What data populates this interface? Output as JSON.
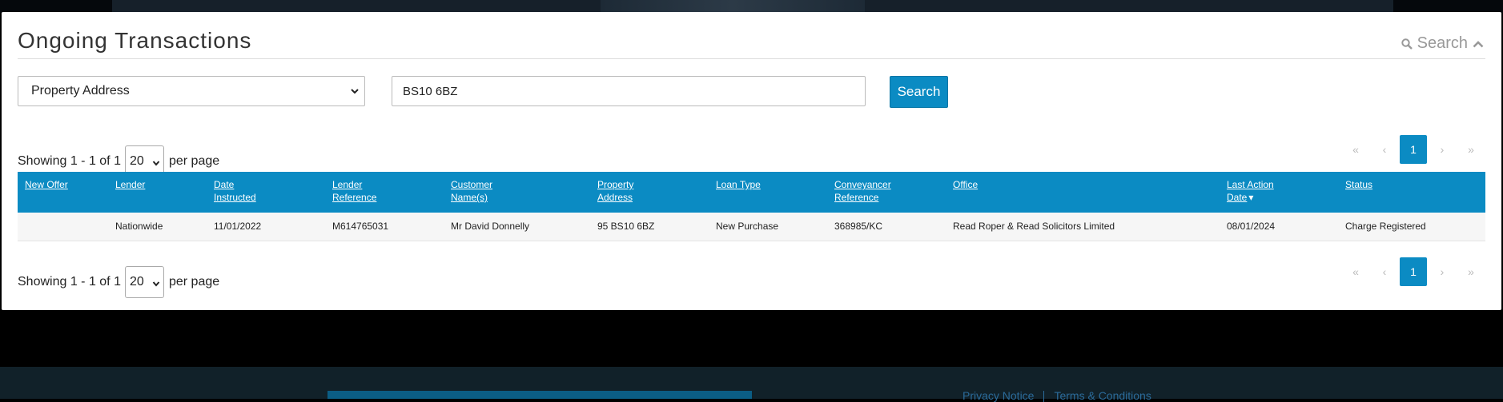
{
  "footer": {
    "links": [
      "Privacy Notice",
      "Terms & Conditions"
    ]
  },
  "panel": {
    "title": "Ongoing Transactions",
    "search_toggle_label": "Search"
  },
  "search": {
    "field_select_value": "Property Address",
    "query_value": "BS10 6BZ",
    "button_label": "Search"
  },
  "pager": {
    "showing_text": "Showing 1 - 1 of 1",
    "per_page_value": "20",
    "per_page_label": "per page",
    "first": "«",
    "prev": "‹",
    "current": "1",
    "next": "›",
    "last": "»"
  },
  "table": {
    "headers": [
      {
        "l1": "New Offer",
        "l2": ""
      },
      {
        "l1": "Lender",
        "l2": ""
      },
      {
        "l1": "Date",
        "l2": "Instructed"
      },
      {
        "l1": "Lender",
        "l2": "Reference"
      },
      {
        "l1": "Customer",
        "l2": "Name(s)"
      },
      {
        "l1": "Property",
        "l2": "Address"
      },
      {
        "l1": "Loan Type",
        "l2": ""
      },
      {
        "l1": "Conveyancer",
        "l2": "Reference"
      },
      {
        "l1": "Office",
        "l2": ""
      },
      {
        "l1": "Last Action",
        "l2": "Date"
      },
      {
        "l1": "Status",
        "l2": ""
      }
    ],
    "sort_indicator": "▾",
    "rows": [
      [
        "",
        "Nationwide",
        "11/01/2022",
        "M614765031",
        "Mr David Donnelly",
        "95 BS10 6BZ",
        "New Purchase",
        "368985/KC",
        "Read Roper & Read Solicitors Limited",
        "08/01/2024",
        "Charge Registered"
      ]
    ]
  },
  "colors": {
    "accent": "#0b8bc3",
    "page_background": "#000000",
    "footer_background": "#112129"
  },
  "icons": {
    "search": "search-icon",
    "collapse": "chevron-up-icon",
    "dropdown": "chevron-down-icon"
  }
}
